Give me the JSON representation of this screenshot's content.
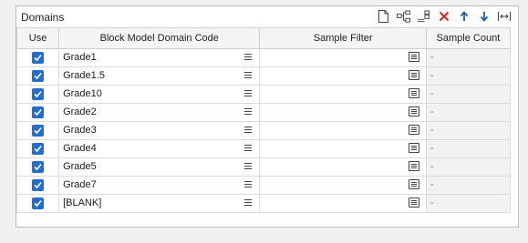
{
  "panel": {
    "title": "Domains",
    "toolbar": [
      {
        "name": "new-icon"
      },
      {
        "name": "add-child-icon"
      },
      {
        "name": "insert-icon"
      },
      {
        "name": "delete-icon"
      },
      {
        "name": "move-up-icon"
      },
      {
        "name": "move-down-icon"
      },
      {
        "name": "fit-columns-icon"
      }
    ],
    "columns": {
      "use": "Use",
      "code": "Block Model Domain Code",
      "filter": "Sample Filter",
      "count": "Sample Count"
    },
    "rows": [
      {
        "use": true,
        "code": "Grade1",
        "filter": "",
        "count": "-"
      },
      {
        "use": true,
        "code": "Grade1.5",
        "filter": "",
        "count": "-"
      },
      {
        "use": true,
        "code": "Grade10",
        "filter": "",
        "count": "-"
      },
      {
        "use": true,
        "code": "Grade2",
        "filter": "",
        "count": "-"
      },
      {
        "use": true,
        "code": "Grade3",
        "filter": "",
        "count": "-"
      },
      {
        "use": true,
        "code": "Grade4",
        "filter": "",
        "count": "-"
      },
      {
        "use": true,
        "code": "Grade5",
        "filter": "",
        "count": "-"
      },
      {
        "use": true,
        "code": "Grade7",
        "filter": "",
        "count": "-"
      },
      {
        "use": true,
        "code": "[BLANK]",
        "filter": "",
        "count": "-"
      }
    ]
  },
  "colors": {
    "checkbox": "#1f6fd1",
    "delete": "#d9261c",
    "arrows": "#1f5fb0"
  }
}
